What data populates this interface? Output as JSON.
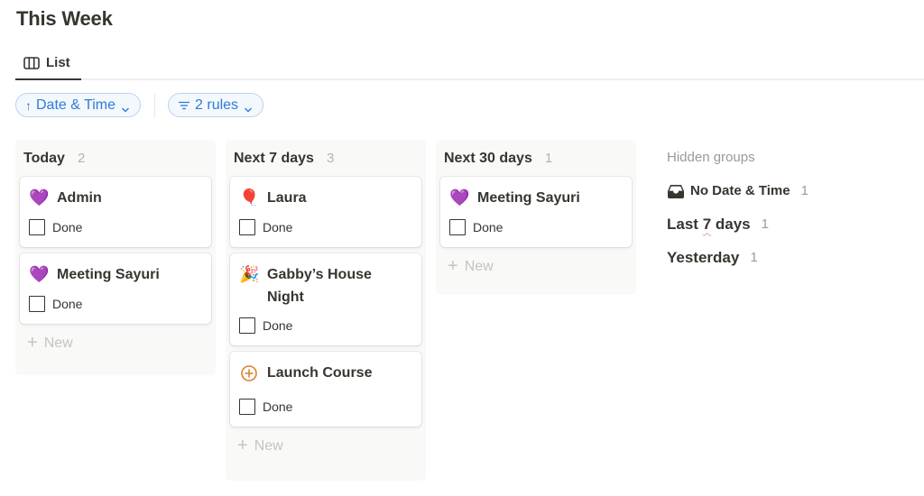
{
  "page": {
    "title": "This Week"
  },
  "tabs": [
    {
      "label": "List",
      "icon": "board-columns-icon",
      "active": true
    }
  ],
  "filters": {
    "sort": {
      "icon": "arrow-up-icon",
      "glyph": "↑",
      "label": "Date & Time"
    },
    "rules": {
      "icon": "filter-lines-icon",
      "glyph": "≡",
      "label": "2 rules"
    }
  },
  "columns": [
    {
      "title": "Today",
      "count": "2",
      "cards": [
        {
          "emoji": "💜",
          "icon": "purple-heart-icon",
          "title": "Admin",
          "done_label": "Done",
          "done": false
        },
        {
          "emoji": "💜",
          "icon": "purple-heart-icon",
          "title": "Meeting Sayuri",
          "done_label": "Done",
          "done": false
        }
      ],
      "new_label": "New"
    },
    {
      "title": "Next 7 days",
      "count": "3",
      "cards": [
        {
          "emoji": "🎈",
          "icon": "balloon-icon",
          "title": "Laura",
          "done_label": "Done",
          "done": false
        },
        {
          "emoji": "🎉",
          "icon": "party-popper-icon",
          "title": "Gabby’s House Night",
          "done_label": "Done",
          "done": false
        },
        {
          "emoji": "⊕",
          "icon": "circle-plus-icon",
          "title": "Launch Course",
          "done_label": "Done",
          "done": false
        }
      ],
      "new_label": "New"
    },
    {
      "title": "Next 30 days",
      "count": "1",
      "cards": [
        {
          "emoji": "💜",
          "icon": "purple-heart-icon",
          "title": "Meeting Sayuri",
          "done_label": "Done",
          "done": false
        }
      ],
      "new_label": "New"
    }
  ],
  "hidden_groups": {
    "header": "Hidden groups",
    "items": [
      {
        "label": "No Date & Time",
        "count": "1",
        "icon": "inbox-icon"
      },
      {
        "label_pre": "Last ",
        "label_mark": "7",
        "label_post": " days",
        "count": "1"
      },
      {
        "label": "Yesterday",
        "count": "1"
      }
    ]
  },
  "colors": {
    "accent": "#2f7bd6",
    "text": "#37352f",
    "muted": "#9b9a97",
    "column_bg": "#f9f9f8",
    "circle_plus": "#d9832e"
  }
}
